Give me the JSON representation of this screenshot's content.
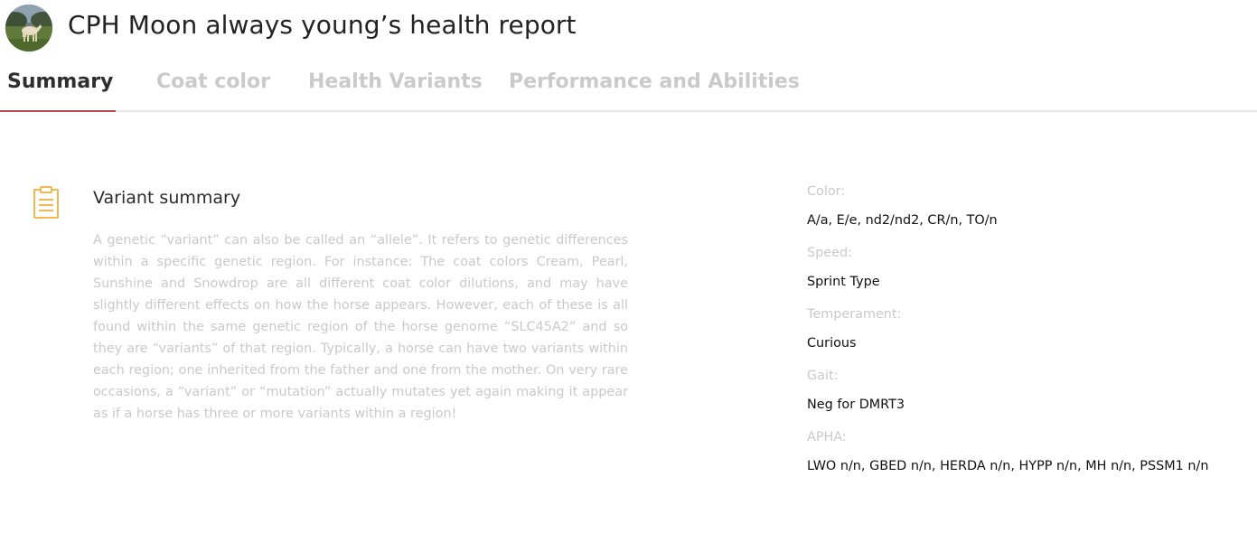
{
  "header": {
    "avatar_icon": "horse-photo-avatar",
    "title": "CPH Moon always young’s health report"
  },
  "tabs": [
    {
      "label": "Summary",
      "active": true
    },
    {
      "label": "Coat color",
      "active": false
    },
    {
      "label": "Health Variants",
      "active": false
    },
    {
      "label": "Performance and Abilities",
      "active": false
    }
  ],
  "colors": {
    "accent": "#b5484a",
    "icon": "#f0b84e",
    "muted_text": "#c9c9c9"
  },
  "summary": {
    "icon": "clipboard-icon",
    "title": "Variant summary",
    "body": "A genetic “variant” can also be called an “allele”. It refers to genetic differences within a specific genetic region. For instance: The coat colors Cream, Pearl, Sunshine and Snowdrop are all different coat color dilutions, and may have slightly different effects on how the horse appears. However, each of these is all found within the same genetic region of the horse genome “SLC45A2” and so they are “variants” of that region. Typically, a horse can have two variants within each region; one inherited from the father and one from the mother. On very rare occasions, a “variant” or “mutation” actually mutates yet again making it appear as if a horse has three or more variants within a region!"
  },
  "details": [
    {
      "label": "Color:",
      "value": "A/a, E/e, nd2/nd2, CR/n, TO/n"
    },
    {
      "label": "Speed:",
      "value": "Sprint Type"
    },
    {
      "label": "Temperament:",
      "value": "Curious"
    },
    {
      "label": "Gait:",
      "value": "Neg for DMRT3"
    },
    {
      "label": "APHA:",
      "value": "LWO n/n, GBED n/n, HERDA n/n, HYPP n/n, MH n/n, PSSM1 n/n"
    }
  ]
}
